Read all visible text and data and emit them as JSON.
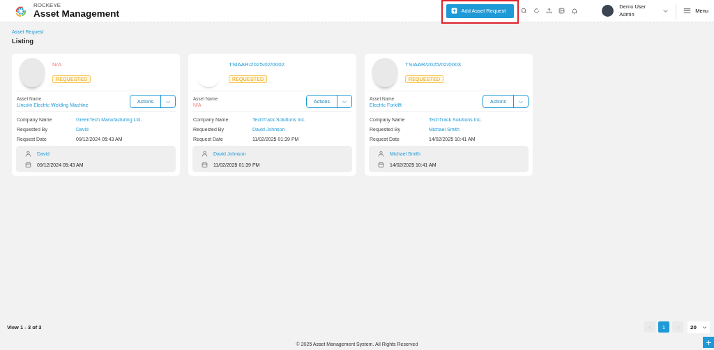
{
  "header": {
    "brand": "ROCKEYE",
    "app_title": "Asset Management",
    "add_button": "Add Asset Request",
    "add_button_highlighted": true,
    "user": {
      "name": "Demo User",
      "role": "Admin"
    },
    "menu_label": "Menu"
  },
  "breadcrumb": "Asset Request",
  "page_title": "Listing",
  "cards": [
    {
      "kind": "photo",
      "title": {
        "text": "N/A",
        "kind": "missing"
      },
      "status": "REQUESTED",
      "asset_label": "Asset Name",
      "asset_name": {
        "text": "Lincoln Electric Welding Machine",
        "kind": "value"
      },
      "actions": "Actions",
      "fields": [
        {
          "label": "Company Name",
          "value": "GreenTech Manufacturing Ltd.",
          "kind": "link"
        },
        {
          "label": "Requested By",
          "value": "David",
          "kind": "link"
        },
        {
          "label": "Request Date",
          "value": "09/12/2024 05:43 AM",
          "kind": "plain"
        }
      ],
      "footer_user": "David",
      "footer_date": "09/12/2024 05:43 AM"
    },
    {
      "kind": "noimage",
      "title": {
        "text": "TSIAAR/2025/02/0002",
        "kind": "value"
      },
      "status": "REQUESTED",
      "asset_label": "Asset Name",
      "asset_name": {
        "text": "N/A",
        "kind": "missing"
      },
      "actions": "Actions",
      "fields": [
        {
          "label": "Company Name",
          "value": "TechTrack Solutions Inc.",
          "kind": "link"
        },
        {
          "label": "Requested By",
          "value": "David Johnson",
          "kind": "link"
        },
        {
          "label": "Request Date",
          "value": "11/02/2025 01:39 PM",
          "kind": "plain"
        }
      ],
      "footer_user": "David Johnson",
      "footer_date": "11/02/2025 01:39 PM"
    },
    {
      "kind": "photo",
      "title": {
        "text": "TSIAAR/2025/02/0003",
        "kind": "value"
      },
      "status": "REQUESTED",
      "asset_label": "Asset Name",
      "asset_name": {
        "text": "Electric Forklift",
        "kind": "value"
      },
      "actions": "Actions",
      "fields": [
        {
          "label": "Company Name",
          "value": "TechTrack Solutions Inc.",
          "kind": "link"
        },
        {
          "label": "Requested By",
          "value": "Michael Smith",
          "kind": "link"
        },
        {
          "label": "Request Date",
          "value": "14/02/2025 10:41 AM",
          "kind": "plain"
        }
      ],
      "footer_user": "Michael Smith",
      "footer_date": "14/02/2025 10:41 AM"
    }
  ],
  "pagination": {
    "summary": "View 1 - 3 of 3",
    "pages": [
      {
        "label": "1",
        "selected": true
      }
    ],
    "page_size": "20"
  },
  "copyright": "© 2025 Asset Management System. All Rights Reserved"
}
